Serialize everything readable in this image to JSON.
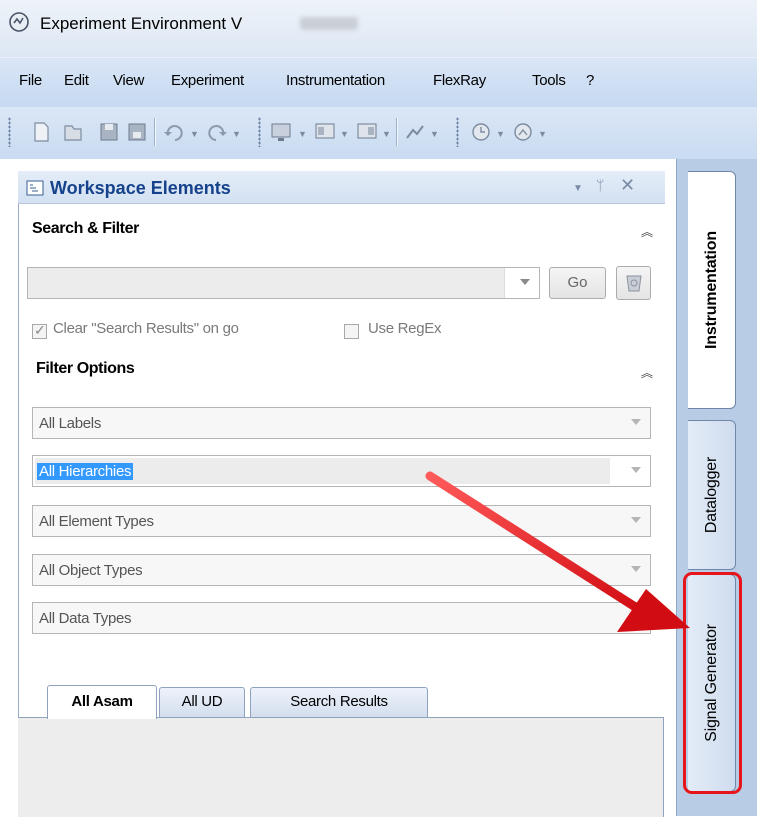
{
  "window": {
    "title": "Experiment Environment V"
  },
  "menu": [
    "File",
    "Edit",
    "View",
    "Experiment",
    "Instrumentation",
    "FlexRay",
    "Tools",
    "?"
  ],
  "panel": {
    "title": "Workspace Elements",
    "search_section": {
      "title": "Search & Filter",
      "search_value": "",
      "go_label": "Go",
      "clear_checkbox": {
        "label": "Clear \"Search Results\" on go",
        "checked": true
      },
      "regex_checkbox": {
        "label": "Use RegEx",
        "checked": false
      }
    },
    "filter_section": {
      "title": "Filter Options",
      "labels": "All Labels",
      "hierarchies": "All Hierarchies",
      "element_types": "All Element Types",
      "object_types": "All Object Types",
      "data_types": "All Data Types"
    },
    "tabs": [
      "All Asam",
      "All UD",
      "Search Results"
    ],
    "active_tab": "All Asam"
  },
  "side_tabs": [
    "Instrumentation",
    "Datalogger",
    "Signal Generator"
  ],
  "active_side_tab": "Instrumentation",
  "annotation": {
    "color": "#e8141b",
    "target": "Signal Generator"
  }
}
